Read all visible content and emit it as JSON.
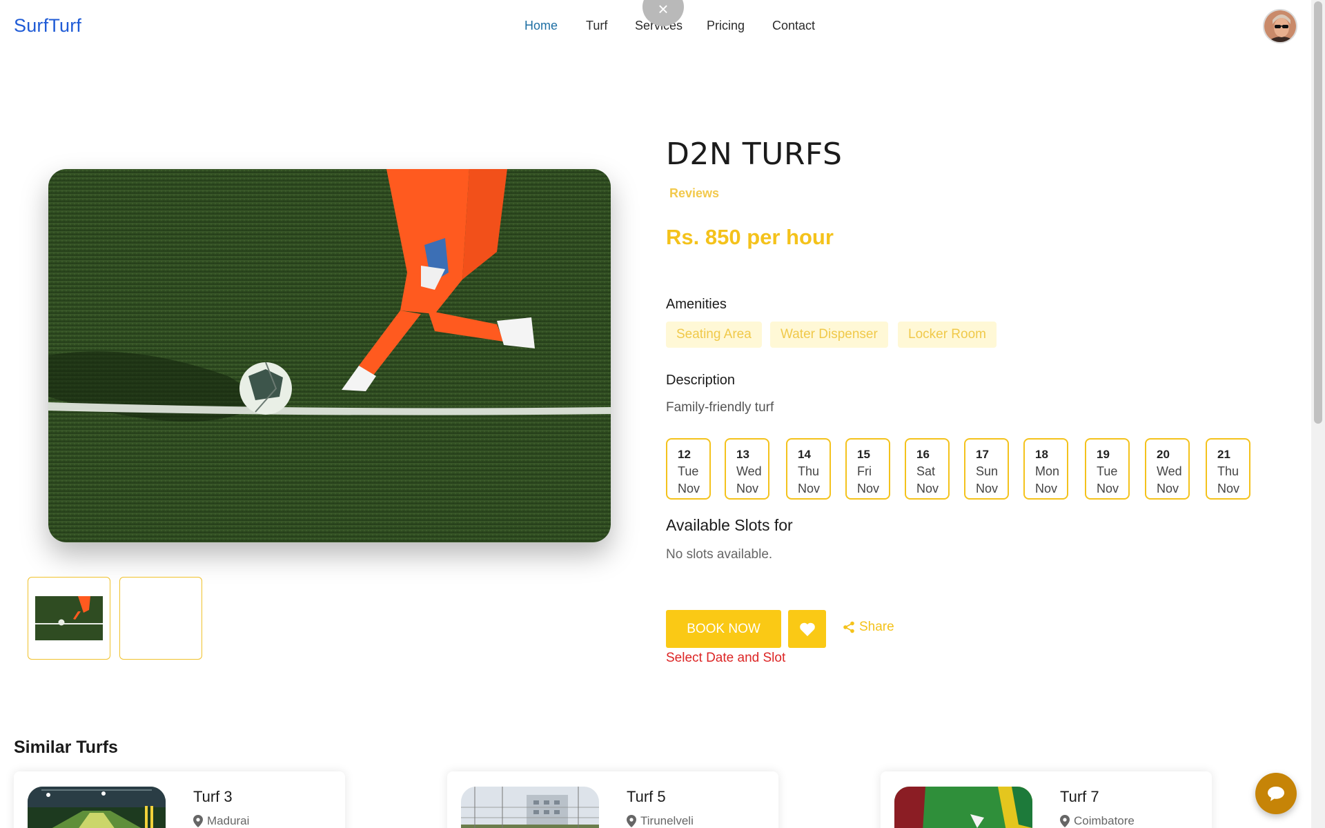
{
  "header": {
    "brand": "SurfTurf",
    "nav": [
      {
        "label": "Home",
        "active": true
      },
      {
        "label": "Turf",
        "active": false
      },
      {
        "label": "Services",
        "active": false
      },
      {
        "label": "Pricing",
        "active": false
      },
      {
        "label": "Contact",
        "active": false
      }
    ],
    "close_icon": "×"
  },
  "turf": {
    "name": "D2N TURFS",
    "reviews_label": "Reviews",
    "price": "Rs. 850 per hour",
    "amenities_heading": "Amenities",
    "amenities": [
      "Seating Area",
      "Water Dispenser",
      "Locker Room"
    ],
    "description_heading": "Description",
    "description": "Family-friendly turf"
  },
  "dates": [
    {
      "day": "12",
      "weekday": "Tue",
      "month": "Nov"
    },
    {
      "day": "13",
      "weekday": "Wed",
      "month": "Nov"
    },
    {
      "day": "14",
      "weekday": "Thu",
      "month": "Nov"
    },
    {
      "day": "15",
      "weekday": "Fri",
      "month": "Nov"
    },
    {
      "day": "16",
      "weekday": "Sat",
      "month": "Nov"
    },
    {
      "day": "17",
      "weekday": "Sun",
      "month": "Nov"
    },
    {
      "day": "18",
      "weekday": "Mon",
      "month": "Nov"
    },
    {
      "day": "19",
      "weekday": "Tue",
      "month": "Nov"
    },
    {
      "day": "20",
      "weekday": "Wed",
      "month": "Nov"
    },
    {
      "day": "21",
      "weekday": "Thu",
      "month": "Nov"
    }
  ],
  "slots": {
    "heading": "Available Slots for",
    "empty_text": "No slots available."
  },
  "actions": {
    "book_label": "BOOK NOW",
    "share_label": "Share",
    "error": "Select Date and Slot"
  },
  "similar": {
    "heading": "Similar Turfs",
    "items": [
      {
        "name": "Turf 3",
        "location": "Madurai"
      },
      {
        "name": "Turf 5",
        "location": "Tirunelveli"
      },
      {
        "name": "Turf 7",
        "location": "Coimbatore"
      }
    ]
  },
  "icons": {
    "close": "close-icon",
    "heart": "heart-icon",
    "share": "share-icon",
    "location": "map-pin-icon",
    "chat": "chat-icon"
  },
  "colors": {
    "brand": "#1f5bd6",
    "accent": "#fac915",
    "nav_active": "#1d6ea3",
    "error": "#dc2525",
    "chat": "#c68407"
  }
}
